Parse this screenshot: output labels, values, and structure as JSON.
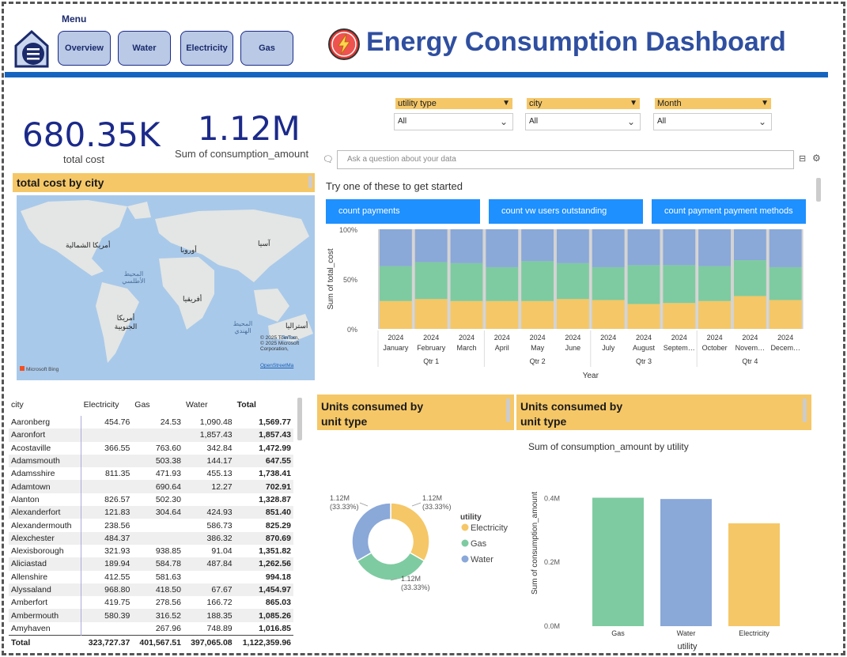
{
  "header": {
    "menu_label": "Menu",
    "nav_buttons": [
      "Overview",
      "Water",
      "Electricity",
      "Gas"
    ],
    "title": "Energy Consumption Dashboard"
  },
  "kpis": {
    "total_cost": {
      "value": "680.35K",
      "label": "total cost"
    },
    "consumption": {
      "value": "1.12M",
      "label": "Sum of consumption_amount"
    }
  },
  "slicers": [
    {
      "label": "utility type",
      "value": "All"
    },
    {
      "label": "city",
      "value": "All"
    },
    {
      "label": "Month",
      "value": "All"
    }
  ],
  "qa": {
    "placeholder": "Ask a question about your data",
    "prompt": "Try one of these to get started",
    "suggestions": [
      "count payments",
      "count vw users outstanding",
      "count payment payment methods"
    ]
  },
  "map": {
    "title": "total cost by city",
    "labels": {
      "north_america": "أمريكا الشمالية",
      "europe": "أوروبا",
      "asia": "آسيا",
      "atlantic": "المحيط الأطلسي",
      "africa": "أفريقيا",
      "south_america": "أمريكا الجنوبية",
      "indian": "المحيط الهندي",
      "australia": "أستراليا"
    },
    "copyright": "© 2025 TomTom, © 2025 Microsoft Corporation,",
    "terms": "Terms",
    "osm": "OpenStreetMa",
    "provider": "Microsoft Bing"
  },
  "table": {
    "columns": [
      "city",
      "Electricity",
      "Gas",
      "Water",
      "Total"
    ],
    "rows": [
      [
        "Aaronberg",
        "454.76",
        "24.53",
        "1,090.48",
        "1,569.77"
      ],
      [
        "Aaronfort",
        "",
        "",
        "1,857.43",
        "1,857.43"
      ],
      [
        "Acostaville",
        "366.55",
        "763.60",
        "342.84",
        "1,472.99"
      ],
      [
        "Adamsmouth",
        "",
        "503.38",
        "144.17",
        "647.55"
      ],
      [
        "Adamsshire",
        "811.35",
        "471.93",
        "455.13",
        "1,738.41"
      ],
      [
        "Adamtown",
        "",
        "690.64",
        "12.27",
        "702.91"
      ],
      [
        "Alanton",
        "826.57",
        "502.30",
        "",
        "1,328.87"
      ],
      [
        "Alexanderfort",
        "121.83",
        "304.64",
        "424.93",
        "851.40"
      ],
      [
        "Alexandermouth",
        "238.56",
        "",
        "586.73",
        "825.29"
      ],
      [
        "Alexchester",
        "484.37",
        "",
        "386.32",
        "870.69"
      ],
      [
        "Alexisborough",
        "321.93",
        "938.85",
        "91.04",
        "1,351.82"
      ],
      [
        "Aliciastad",
        "189.94",
        "584.78",
        "487.84",
        "1,262.56"
      ],
      [
        "Allenshire",
        "412.55",
        "581.63",
        "",
        "994.18"
      ],
      [
        "Alyssaland",
        "968.80",
        "418.50",
        "67.67",
        "1,454.97"
      ],
      [
        "Amberfort",
        "419.75",
        "278.56",
        "166.72",
        "865.03"
      ],
      [
        "Ambermouth",
        "580.39",
        "316.52",
        "188.35",
        "1,085.26"
      ],
      [
        "Amyhaven",
        "",
        "267.96",
        "748.89",
        "1,016.85"
      ]
    ],
    "total_row": [
      "Total",
      "323,727.37",
      "401,567.51",
      "397,065.08",
      "1,122,359.96"
    ]
  },
  "panels": {
    "donut_title": "Units consumed by unit type",
    "bar_title": "Units consumed by unit type"
  },
  "colors": {
    "electricity": "#f5c767",
    "gas": "#7ecba1",
    "water": "#8aa8d8",
    "accent": "#1565c0",
    "title": "#2f4fa0"
  },
  "chart_data": [
    {
      "type": "bar",
      "stacked": "100%",
      "title": "",
      "xlabel": "Year",
      "ylabel": "Sum of total_cost",
      "yticks": [
        "0%",
        "50%",
        "100%"
      ],
      "categories": [
        "January",
        "February",
        "March",
        "April",
        "May",
        "June",
        "July",
        "August",
        "Septem…",
        "October",
        "Novem…",
        "Decem…"
      ],
      "year_label": "2024",
      "quarters": [
        "Qtr 1",
        "Qtr 2",
        "Qtr 3",
        "Qtr 4"
      ],
      "series": [
        {
          "name": "Electricity",
          "values": [
            28,
            30,
            28,
            28,
            28,
            30,
            29,
            25,
            26,
            28,
            33,
            29
          ]
        },
        {
          "name": "Gas",
          "values": [
            35,
            37,
            38,
            34,
            40,
            36,
            33,
            39,
            38,
            35,
            36,
            33
          ]
        },
        {
          "name": "Water",
          "values": [
            37,
            33,
            34,
            38,
            32,
            34,
            38,
            36,
            36,
            37,
            31,
            38
          ]
        }
      ]
    },
    {
      "type": "pie",
      "donut": true,
      "legend_title": "utility",
      "categories": [
        "Electricity",
        "Gas",
        "Water"
      ],
      "values": [
        33.33,
        33.33,
        33.33
      ],
      "data_labels": [
        {
          "value": "1.12M",
          "pct": "(33.33%)"
        },
        {
          "value": "1.12M",
          "pct": "(33.33%)"
        },
        {
          "value": "1.12M",
          "pct": "(33.33%)"
        }
      ]
    },
    {
      "type": "bar",
      "title": "Sum of consumption_amount by utility",
      "xlabel": "utility",
      "ylabel": "Sum of consumption_amount",
      "categories": [
        "Gas",
        "Water",
        "Electricity"
      ],
      "values": [
        0.402,
        0.398,
        0.322
      ],
      "yticks": [
        "0.0M",
        "0.2M",
        "0.4M"
      ],
      "ylim": [
        0,
        0.48
      ]
    }
  ]
}
